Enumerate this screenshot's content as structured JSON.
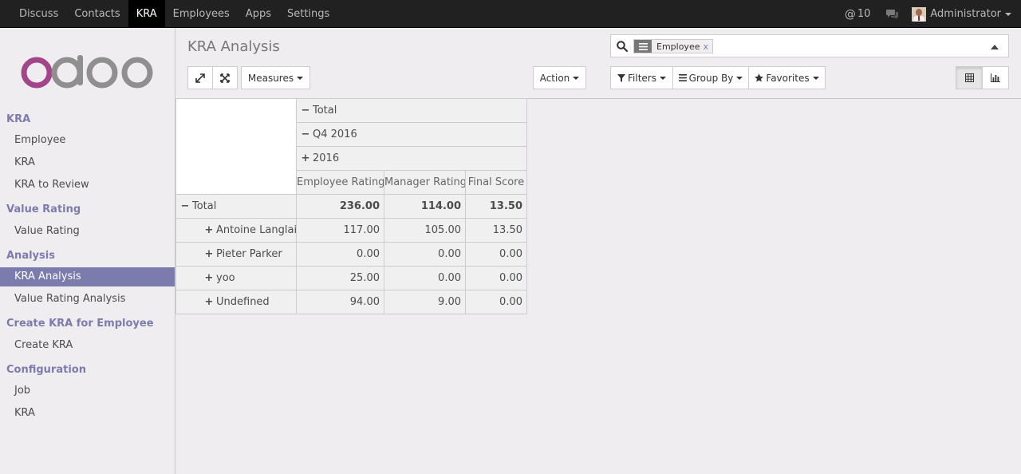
{
  "topnav": {
    "items": [
      {
        "label": "Discuss"
      },
      {
        "label": "Contacts"
      },
      {
        "label": "KRA"
      },
      {
        "label": "Employees"
      },
      {
        "label": "Apps"
      },
      {
        "label": "Settings"
      }
    ],
    "active_index": 2,
    "mention_count": "10",
    "user_name": "Administrator"
  },
  "sidebar": {
    "sections": [
      {
        "title": "KRA",
        "items": [
          "Employee",
          "KRA",
          "KRA to Review"
        ]
      },
      {
        "title": "Value Rating",
        "items": [
          "Value Rating"
        ]
      },
      {
        "title": "Analysis",
        "items": [
          "KRA Analysis",
          "Value Rating Analysis"
        ]
      },
      {
        "title": "Create KRA for Employee",
        "items": [
          "Create KRA"
        ]
      },
      {
        "title": "Configuration",
        "items": [
          "Job",
          "KRA"
        ]
      }
    ],
    "active_item": "KRA Analysis"
  },
  "page": {
    "title": "KRA Analysis"
  },
  "search": {
    "facet_value": "Employee",
    "facet_remove": "x"
  },
  "toolbar": {
    "measures_label": "Measures",
    "action_label": "Action",
    "filters_label": "Filters",
    "groupby_label": "Group By",
    "favorites_label": "Favorites",
    "active_view": "pivot"
  },
  "pivot": {
    "col_headers": [
      {
        "symbol": "−",
        "label": "Total"
      },
      {
        "symbol": "−",
        "label": "Q4 2016"
      },
      {
        "symbol": "+",
        "label": "2016"
      }
    ],
    "measures": [
      "Employee Rating",
      "Manager Rating",
      "Final Score"
    ],
    "total_row": {
      "symbol": "−",
      "label": "Total",
      "values": [
        "236.00",
        "114.00",
        "13.50"
      ]
    },
    "rows": [
      {
        "symbol": "+",
        "label": "Antoine Langlais",
        "values": [
          "117.00",
          "105.00",
          "13.50"
        ]
      },
      {
        "symbol": "+",
        "label": "Pieter Parker",
        "values": [
          "0.00",
          "0.00",
          "0.00"
        ]
      },
      {
        "symbol": "+",
        "label": "yoo",
        "values": [
          "25.00",
          "0.00",
          "0.00"
        ]
      },
      {
        "symbol": "+",
        "label": "Undefined",
        "values": [
          "94.00",
          "9.00",
          "0.00"
        ]
      }
    ]
  },
  "colors": {
    "brand": "#7c7bad",
    "topbar": "#212121",
    "logo_o": "#a24689",
    "logo_grey": "#8f8f8f"
  }
}
